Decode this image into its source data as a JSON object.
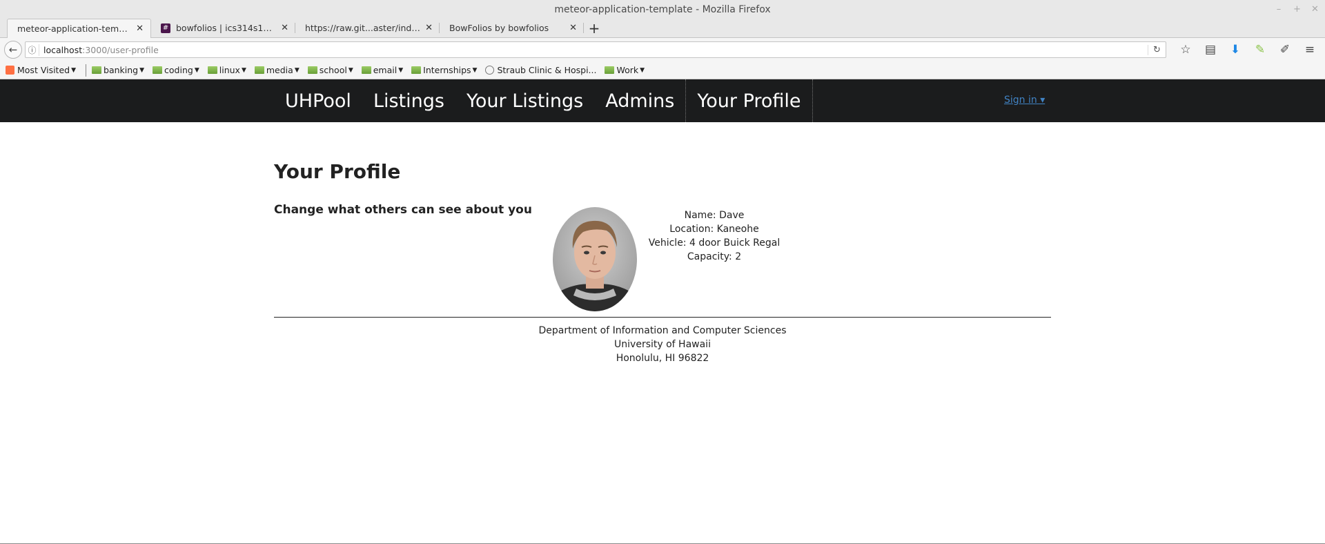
{
  "window": {
    "title": "meteor-application-template - Mozilla Firefox",
    "controls": [
      "–",
      "+",
      "✕"
    ]
  },
  "tabs": [
    {
      "label": "meteor-application-template",
      "active": true
    },
    {
      "label": "bowfolios | ics314s17 Sla...",
      "favicon": "#"
    },
    {
      "label": "https://raw.git...aster/index.md"
    },
    {
      "label": "BowFolios by bowfolios"
    }
  ],
  "newtab_label": "+",
  "navbar": {
    "url_host": "localhost",
    "url_path": ":3000/user-profile",
    "info_icon": "ⓘ",
    "back_icon": "←",
    "reload_icon": "↻",
    "icons": [
      "☆",
      "▤",
      "⬇",
      "✎",
      "✐",
      "≡"
    ]
  },
  "bookmarks": [
    {
      "label": "Most Visited",
      "type": "most-visited"
    },
    {
      "label": "banking",
      "type": "folder"
    },
    {
      "label": "coding",
      "type": "folder"
    },
    {
      "label": "linux",
      "type": "folder"
    },
    {
      "label": "media",
      "type": "folder"
    },
    {
      "label": "school",
      "type": "folder"
    },
    {
      "label": "email",
      "type": "folder"
    },
    {
      "label": "Internships",
      "type": "folder"
    },
    {
      "label": "Straub Clinic & Hospi...",
      "type": "site"
    },
    {
      "label": "Work",
      "type": "folder"
    }
  ],
  "site": {
    "menu": [
      "UHPool",
      "Listings",
      "Your Listings",
      "Admins",
      "Your Profile"
    ],
    "current_item": "Your Profile",
    "signin": "Sign in ▾"
  },
  "page": {
    "title": "Your Profile",
    "subheader": "Change what others can see about you",
    "profile": [
      "Name: Dave",
      "Location: Kaneohe",
      "Vehicle: 4 door Buick Regal",
      "Capacity: 2"
    ]
  },
  "footer": [
    "Department of Information and Computer Sciences",
    "University of Hawaii",
    "Honolulu, HI 96822"
  ]
}
